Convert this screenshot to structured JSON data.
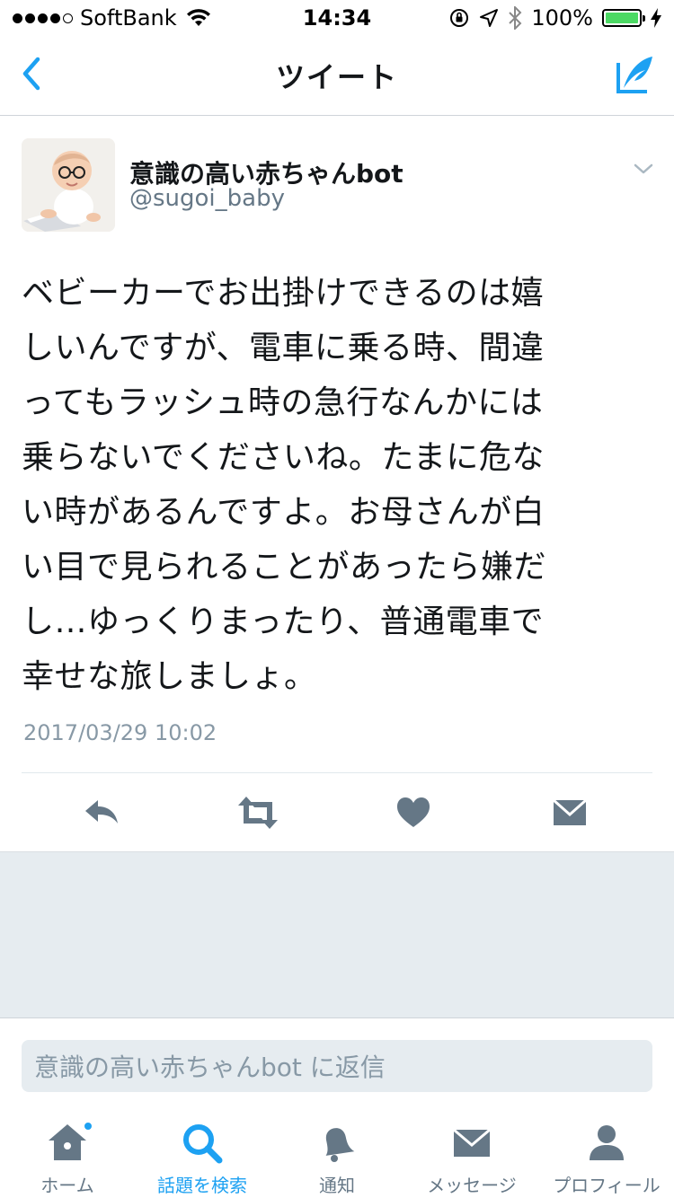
{
  "status_bar": {
    "carrier": "SoftBank",
    "time": "14:34",
    "battery": "100%",
    "battery_level": 1.0
  },
  "nav": {
    "title": "ツイート"
  },
  "tweet": {
    "display_name": "意識の高い赤ちゃんbot",
    "handle": "@sugoi_baby",
    "text_lines": [
      "ベビーカーでお出掛けできるのは嬉",
      "しいんですが、電車に乗る時、間違",
      "ってもラッシュ時の急行なんかには",
      "乗らないでくださいね。たまに危な",
      "い時があるんですよ。お母さんが白",
      "い目で見られることがあったら嫌だ",
      "し…ゆっくりまったり、普通電車で",
      "幸せな旅しましょ。"
    ],
    "timestamp": "2017/03/29 10:02"
  },
  "reply": {
    "placeholder": "意識の高い赤ちゃんbot に返信"
  },
  "tabs": [
    {
      "label": "ホーム",
      "icon": "home-icon",
      "active": false,
      "badge": true
    },
    {
      "label": "話題を検索",
      "icon": "search-icon",
      "active": true,
      "badge": false
    },
    {
      "label": "通知",
      "icon": "bell-icon",
      "active": false,
      "badge": false
    },
    {
      "label": "メッセージ",
      "icon": "envelope-icon",
      "active": false,
      "badge": false
    },
    {
      "label": "プロフィール",
      "icon": "person-icon",
      "active": false,
      "badge": false
    }
  ],
  "colors": {
    "accent": "#1da1f2",
    "icon_gray": "#657786",
    "battery_green": "#4cd964"
  }
}
